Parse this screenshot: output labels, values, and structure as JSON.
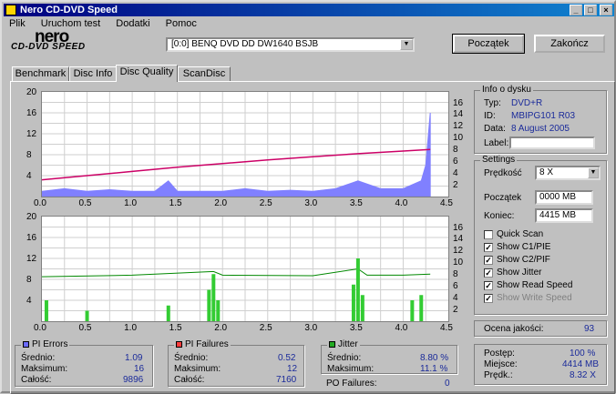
{
  "window": {
    "title": "Nero CD-DVD Speed"
  },
  "menu": [
    "Plik",
    "Uruchom test",
    "Dodatki",
    "Pomoc"
  ],
  "logo": {
    "brand": "nero",
    "product": "CD-DVD SPEED"
  },
  "drive": {
    "selected": "[0:0]  BENQ DVD DD DW1640 BSJB"
  },
  "buttons": {
    "start": "Początek",
    "exit": "Zakończ"
  },
  "tabs": [
    "Benchmark",
    "Disc Info",
    "Disc Quality",
    "ScanDisc"
  ],
  "active_tab": "Disc Quality",
  "disc_info": {
    "title": "Info o dysku",
    "type_label": "Typ:",
    "type": "DVD+R",
    "id_label": "ID:",
    "id": "MBIPG101 R03",
    "date_label": "Data:",
    "date": "8 August 2005",
    "label_label": "Label:",
    "label": ""
  },
  "settings": {
    "title": "Settings",
    "speed_label": "Prędkość",
    "speed": "8 X",
    "start_label": "Początek",
    "start": "0000 MB",
    "end_label": "Koniec:",
    "end": "4415 MB",
    "checks": [
      {
        "label": "Quick Scan",
        "checked": false,
        "enabled": true
      },
      {
        "label": "Show C1/PIE",
        "checked": true,
        "enabled": true
      },
      {
        "label": "Show C2/PIF",
        "checked": true,
        "enabled": true
      },
      {
        "label": "Show Jitter",
        "checked": true,
        "enabled": true
      },
      {
        "label": "Show Read Speed",
        "checked": true,
        "enabled": true
      },
      {
        "label": "Show Write Speed",
        "checked": true,
        "enabled": false
      }
    ]
  },
  "quality": {
    "label": "Ocena jakości:",
    "value": "93"
  },
  "progress": {
    "progress_label": "Postęp:",
    "progress": "100 %",
    "place_label": "Miejsce:",
    "place": "4414 MB",
    "speed_label": "Prędk.:",
    "speed": "8.32 X"
  },
  "pi_errors": {
    "title": "PI Errors",
    "color": "#6b6bff",
    "avg_label": "Średnio:",
    "avg": "1.09",
    "max_label": "Maksimum:",
    "max": "16",
    "total_label": "Całość:",
    "total": "9896"
  },
  "pi_failures": {
    "title": "PI Failures",
    "color": "#ff3c3c",
    "avg_label": "Średnio:",
    "avg": "0.52",
    "max_label": "Maksimum:",
    "max": "12",
    "total_label": "Całość:",
    "total": "7160"
  },
  "jitter": {
    "title": "Jitter",
    "color": "#22aa22",
    "avg_label": "Średnio:",
    "avg": "8.80 %",
    "max_label": "Maksimum:",
    "max": "11.1 %",
    "po_label": "PO Failures:",
    "po": "0"
  },
  "chart_data": [
    {
      "type": "area",
      "x_ticks": [
        "0.0",
        "0.5",
        "1.0",
        "1.5",
        "2.0",
        "2.5",
        "3.0",
        "3.5",
        "4.0",
        "4.5"
      ],
      "y_left_ticks": [
        "20",
        "16",
        "12",
        "8",
        "4"
      ],
      "y_right_ticks": [
        "16",
        "14",
        "12",
        "10",
        "8",
        "6",
        "4",
        "2"
      ],
      "ylim": [
        0,
        20
      ],
      "xlim": [
        0,
        4.5
      ],
      "series": [
        {
          "name": "PI Errors",
          "color": "#8080ff",
          "values": [
            [
              0,
              1
            ],
            [
              0.25,
              1.5
            ],
            [
              0.5,
              1
            ],
            [
              0.75,
              1.3
            ],
            [
              1,
              1
            ],
            [
              1.25,
              1
            ],
            [
              1.4,
              3
            ],
            [
              1.5,
              1
            ],
            [
              1.75,
              1
            ],
            [
              2,
              1
            ],
            [
              2.25,
              1.5
            ],
            [
              2.5,
              1
            ],
            [
              2.75,
              1.2
            ],
            [
              3,
              1
            ],
            [
              3.25,
              1.5
            ],
            [
              3.5,
              3
            ],
            [
              3.75,
              1.5
            ],
            [
              4,
              1.5
            ],
            [
              4.2,
              3
            ],
            [
              4.25,
              6
            ],
            [
              4.3,
              16
            ]
          ]
        },
        {
          "name": "Read Speed",
          "color": "#cc0066",
          "values": [
            [
              0,
              3.2
            ],
            [
              0.5,
              4
            ],
            [
              1,
              4.8
            ],
            [
              1.5,
              5.6
            ],
            [
              2,
              6.3
            ],
            [
              2.5,
              7
            ],
            [
              3,
              7.6
            ],
            [
              3.5,
              8.2
            ],
            [
              4,
              8.7
            ],
            [
              4.3,
              9
            ]
          ]
        }
      ]
    },
    {
      "type": "line",
      "x_ticks": [
        "0.0",
        "0.5",
        "1.0",
        "1.5",
        "2.0",
        "2.5",
        "3.0",
        "3.5",
        "4.0",
        "4.5"
      ],
      "y_left_ticks": [
        "20",
        "16",
        "12",
        "8",
        "4"
      ],
      "y_right_ticks": [
        "16",
        "14",
        "12",
        "10",
        "8",
        "6",
        "4",
        "2"
      ],
      "ylim": [
        0,
        20
      ],
      "xlim": [
        0,
        4.5
      ],
      "series": [
        {
          "name": "PI Failures",
          "color": "#33cc33",
          "values": [
            [
              0.05,
              4
            ],
            [
              0.5,
              2
            ],
            [
              1.4,
              3
            ],
            [
              1.85,
              6
            ],
            [
              1.9,
              9
            ],
            [
              1.95,
              4
            ],
            [
              3.45,
              7
            ],
            [
              3.5,
              12
            ],
            [
              3.55,
              5
            ],
            [
              4.1,
              4
            ],
            [
              4.2,
              5
            ]
          ]
        },
        {
          "name": "Jitter",
          "color": "#008800",
          "values": [
            [
              0,
              8.5
            ],
            [
              1,
              8.8
            ],
            [
              1.9,
              9.5
            ],
            [
              2,
              8.8
            ],
            [
              3,
              8.7
            ],
            [
              3.5,
              10
            ],
            [
              3.6,
              8.8
            ],
            [
              4,
              8.8
            ],
            [
              4.3,
              9
            ]
          ]
        }
      ]
    }
  ]
}
